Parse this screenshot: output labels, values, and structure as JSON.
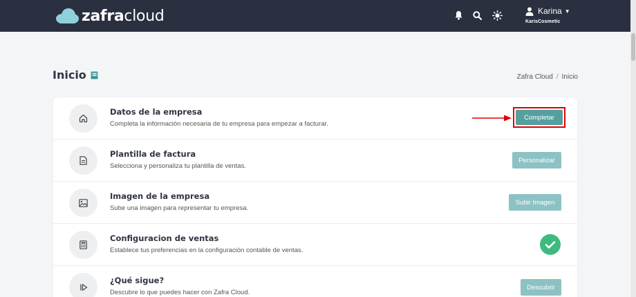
{
  "header": {
    "logo": {
      "bold": "zafra",
      "light": "cloud"
    },
    "icons": [
      "bell-icon",
      "search-icon",
      "sun-icon"
    ],
    "user": {
      "name": "Karina",
      "company": "KarisCosmetic"
    }
  },
  "page": {
    "title": "Inicio",
    "breadcrumb": [
      "Zafra Cloud",
      "/",
      "Inicio"
    ]
  },
  "onboarding": {
    "items": [
      {
        "icon": "home-icon",
        "title": "Datos de la empresa",
        "description": "Completa la información necesaria de tu empresa para empezar a facturar.",
        "action": "Completar",
        "state": "pending-highlighted"
      },
      {
        "icon": "document-icon",
        "title": "Plantilla de factura",
        "description": "Selecciona y personaliza tu plantilla de ventas.",
        "action": "Personalizar",
        "state": "pending"
      },
      {
        "icon": "image-icon",
        "title": "Imagen de la empresa",
        "description": "Sube una imagen para representar tu empresa.",
        "action": "Subir Imagen",
        "state": "pending"
      },
      {
        "icon": "calculator-icon",
        "title": "Configuracion de ventas",
        "description": "Establece tus preferencias en la configuración contable de ventas.",
        "action": null,
        "state": "done"
      },
      {
        "icon": "play-next-icon",
        "title": "¿Qué sigue?",
        "description": "Descubre lo que puedes hacer con Zafra Cloud.",
        "action": "Descubrir",
        "state": "pending"
      }
    ]
  },
  "colors": {
    "topbar": "#2b3040",
    "primary_button": "#55a09f",
    "muted_button": "#8dc2c4",
    "success": "#3fba7f",
    "annotation": "#e00000"
  }
}
